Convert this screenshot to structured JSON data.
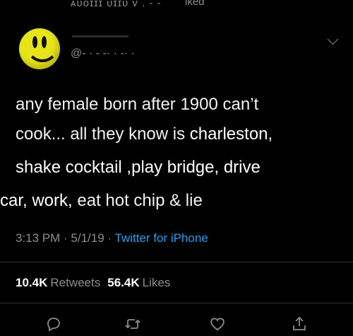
{
  "header": {
    "liked_text": "iked",
    "blurred_text": "ᴀᴜᴏɪɪɪ ᴜɪɪᴜ ᴠ .  -  -"
  },
  "author": {
    "handle": "@- ·  - -·  · -· ·",
    "avatar": "smiley-face-avatar"
  },
  "tweet": {
    "lines": [
      {
        "a": "any female born after 19",
        "b": "00",
        "c": "  can’t"
      },
      {
        "a": "cook... all they know is ",
        "b": "charleston",
        "c": ","
      },
      {
        "a": "  shake cocktail",
        "b": "   ,play bridge, drive",
        "c": ""
      },
      {
        "a": "car, work",
        "b": ",",
        "c": " eat hot chip & lie"
      }
    ]
  },
  "meta": {
    "time": "3:13 PM",
    "sep1": " · ",
    "date": "5/1/19",
    "sep2": " · ",
    "source": "Twitter for iPhone"
  },
  "stats": {
    "retweets_count": "10.4K",
    "retweets_label": "Retweets",
    "likes_count": "56.4K",
    "likes_label": "Likes"
  },
  "actions": {
    "icons": [
      "reply-icon",
      "retweet-icon",
      "like-icon",
      "share-icon"
    ]
  },
  "colors": {
    "background": "#000000",
    "secondary_text": "#8a8d91",
    "link": "#1da1f2",
    "avatar_yellow": "#e7e51a"
  }
}
